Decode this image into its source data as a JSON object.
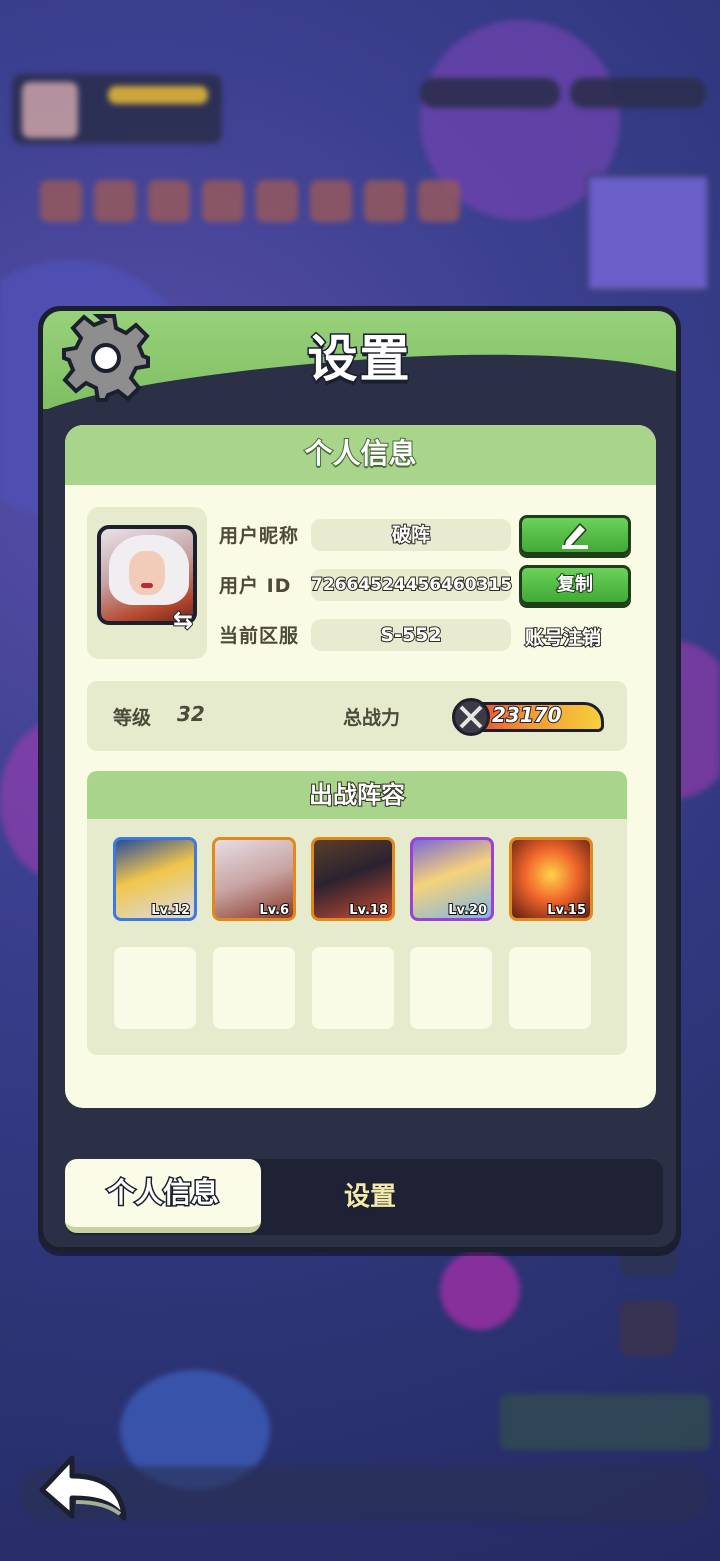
{
  "panel": {
    "title": "设置"
  },
  "card": {
    "title": "个人信息"
  },
  "profile": {
    "nickname_label": "用户昵称",
    "nickname": "破阵",
    "id_label": "用户 ID",
    "user_id": "72664524456460315",
    "server_label": "当前区服",
    "server": "S-552",
    "copy_label": "复制",
    "delete_account_label": "账号注销"
  },
  "stats": {
    "level_label": "等级",
    "level": "32",
    "power_label": "总战力",
    "power": "23170"
  },
  "lineup": {
    "title": "出战阵容",
    "heroes": [
      {
        "level": "Lv.12",
        "border": "#3d7ad9"
      },
      {
        "level": "Lv.6",
        "border": "#e08a1e"
      },
      {
        "level": "Lv.18",
        "border": "#e08a1e"
      },
      {
        "level": "Lv.20",
        "border": "#9b42d6"
      },
      {
        "level": "Lv.15",
        "border": "#e08a1e"
      }
    ]
  },
  "tabs": {
    "personal": "个人信息",
    "settings": "设置"
  },
  "icons": {
    "gear": "gear-icon",
    "edit": "pencil-icon",
    "swap": "swap-icon",
    "back": "back-arrow-icon",
    "power": "swords-icon"
  }
}
